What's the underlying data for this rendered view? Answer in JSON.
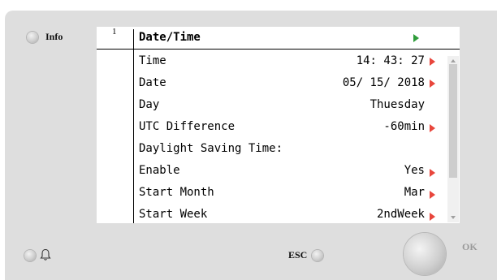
{
  "left_panel": {
    "info_label": "Info",
    "bell_icon": "bell-icon"
  },
  "screen": {
    "page_number": "1",
    "menu_title": "Date/Time",
    "rows": [
      {
        "label": "Time",
        "value": "14: 43: 27",
        "has_arrow": true
      },
      {
        "label": "Date",
        "value": "05/ 15/ 2018",
        "has_arrow": true
      },
      {
        "label": "Day",
        "value": "Thuesday",
        "has_arrow": false
      },
      {
        "label": "UTC Difference",
        "value": "-60min",
        "has_arrow": true
      },
      {
        "label": "Daylight Saving Time:",
        "value": "",
        "has_arrow": false
      },
      {
        "label": "Enable",
        "value": "Yes",
        "has_arrow": true
      },
      {
        "label": "Start Month",
        "value": "Mar",
        "has_arrow": true
      },
      {
        "label": "Start Week",
        "value": "2ndWeek",
        "has_arrow": true
      }
    ]
  },
  "buttons": {
    "esc_label": "ESC",
    "ok_label": "OK"
  },
  "colors": {
    "panel": "#dedede",
    "arrow_red": "#e8463c",
    "arrow_green": "#2e9c3a"
  }
}
